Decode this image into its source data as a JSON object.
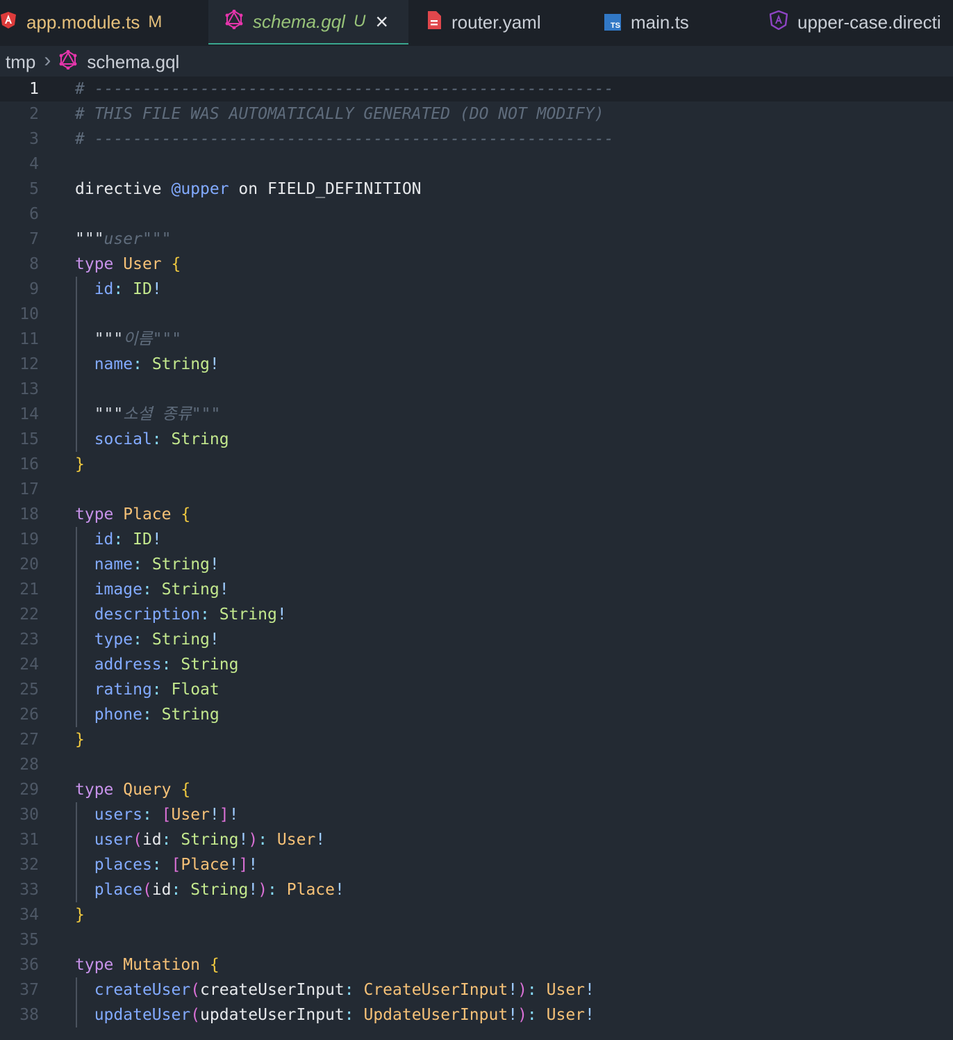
{
  "tabs": [
    {
      "label": "app.module.ts",
      "status": "M",
      "icon": "angular-icon",
      "color": "#e5c07b"
    },
    {
      "label": "schema.gql",
      "status": "U",
      "icon": "graphql-icon",
      "color": "#98c379"
    },
    {
      "label": "router.yaml",
      "status": "",
      "icon": "yaml-file-icon",
      "color": "#c9ced6"
    },
    {
      "label": "main.ts",
      "status": "",
      "icon": "typescript-icon",
      "color": "#c9ced6"
    },
    {
      "label": "upper-case.directi",
      "status": "",
      "icon": "angular-directive-icon",
      "color": "#c9ced6"
    }
  ],
  "ts_badge": "TS",
  "close_glyph": "×",
  "breadcrumb": {
    "folder": "tmp",
    "separator": "›",
    "file": "schema.gql"
  },
  "editor": {
    "current_line": 1,
    "lines": [
      [
        [
          "c-comment",
          "# ------------------------------------------------------"
        ]
      ],
      [
        [
          "c-comment",
          "# THIS FILE WAS AUTOMATICALLY GENERATED (DO NOT MODIFY)"
        ]
      ],
      [
        [
          "c-comment",
          "# ------------------------------------------------------"
        ]
      ],
      [],
      [
        [
          "c-plain",
          "directive "
        ],
        [
          "c-dir",
          "@upper"
        ],
        [
          "c-plain",
          " on FIELD_DEFINITION"
        ]
      ],
      [],
      [
        [
          "c-quote",
          "\"\"\""
        ],
        [
          "c-comment",
          "user"
        ],
        [
          "c-comment",
          "\"\"\""
        ]
      ],
      [
        [
          "c-kw",
          "type"
        ],
        [
          "c-plain",
          " "
        ],
        [
          "c-type",
          "User"
        ],
        [
          "c-plain",
          " "
        ],
        [
          "c-brace",
          "{"
        ]
      ],
      [
        [
          "c-plain",
          "  "
        ],
        [
          "c-field",
          "id"
        ],
        [
          "c-punc",
          ":"
        ],
        [
          "c-plain",
          " "
        ],
        [
          "c-scalar",
          "ID"
        ],
        [
          "c-bang",
          "!"
        ]
      ],
      [],
      [
        [
          "c-plain",
          "  "
        ],
        [
          "c-quote",
          "\"\"\""
        ],
        [
          "c-comment",
          "이름"
        ],
        [
          "c-comment",
          "\"\"\""
        ]
      ],
      [
        [
          "c-plain",
          "  "
        ],
        [
          "c-field",
          "name"
        ],
        [
          "c-punc",
          ":"
        ],
        [
          "c-plain",
          " "
        ],
        [
          "c-scalar",
          "String"
        ],
        [
          "c-bang",
          "!"
        ]
      ],
      [],
      [
        [
          "c-plain",
          "  "
        ],
        [
          "c-quote",
          "\"\"\""
        ],
        [
          "c-comment",
          "소셜 종류"
        ],
        [
          "c-comment",
          "\"\"\""
        ]
      ],
      [
        [
          "c-plain",
          "  "
        ],
        [
          "c-field",
          "social"
        ],
        [
          "c-punc",
          ":"
        ],
        [
          "c-plain",
          " "
        ],
        [
          "c-scalar",
          "String"
        ]
      ],
      [
        [
          "c-brace",
          "}"
        ]
      ],
      [],
      [
        [
          "c-kw",
          "type"
        ],
        [
          "c-plain",
          " "
        ],
        [
          "c-type",
          "Place"
        ],
        [
          "c-plain",
          " "
        ],
        [
          "c-brace",
          "{"
        ]
      ],
      [
        [
          "c-plain",
          "  "
        ],
        [
          "c-field",
          "id"
        ],
        [
          "c-punc",
          ":"
        ],
        [
          "c-plain",
          " "
        ],
        [
          "c-scalar",
          "ID"
        ],
        [
          "c-bang",
          "!"
        ]
      ],
      [
        [
          "c-plain",
          "  "
        ],
        [
          "c-field",
          "name"
        ],
        [
          "c-punc",
          ":"
        ],
        [
          "c-plain",
          " "
        ],
        [
          "c-scalar",
          "String"
        ],
        [
          "c-bang",
          "!"
        ]
      ],
      [
        [
          "c-plain",
          "  "
        ],
        [
          "c-field",
          "image"
        ],
        [
          "c-punc",
          ":"
        ],
        [
          "c-plain",
          " "
        ],
        [
          "c-scalar",
          "String"
        ],
        [
          "c-bang",
          "!"
        ]
      ],
      [
        [
          "c-plain",
          "  "
        ],
        [
          "c-field",
          "description"
        ],
        [
          "c-punc",
          ":"
        ],
        [
          "c-plain",
          " "
        ],
        [
          "c-scalar",
          "String"
        ],
        [
          "c-bang",
          "!"
        ]
      ],
      [
        [
          "c-plain",
          "  "
        ],
        [
          "c-field",
          "type"
        ],
        [
          "c-punc",
          ":"
        ],
        [
          "c-plain",
          " "
        ],
        [
          "c-scalar",
          "String"
        ],
        [
          "c-bang",
          "!"
        ]
      ],
      [
        [
          "c-plain",
          "  "
        ],
        [
          "c-field",
          "address"
        ],
        [
          "c-punc",
          ":"
        ],
        [
          "c-plain",
          " "
        ],
        [
          "c-scalar",
          "String"
        ]
      ],
      [
        [
          "c-plain",
          "  "
        ],
        [
          "c-field",
          "rating"
        ],
        [
          "c-punc",
          ":"
        ],
        [
          "c-plain",
          " "
        ],
        [
          "c-scalar",
          "Float"
        ]
      ],
      [
        [
          "c-plain",
          "  "
        ],
        [
          "c-field",
          "phone"
        ],
        [
          "c-punc",
          ":"
        ],
        [
          "c-plain",
          " "
        ],
        [
          "c-scalar",
          "String"
        ]
      ],
      [
        [
          "c-brace",
          "}"
        ]
      ],
      [],
      [
        [
          "c-kw",
          "type"
        ],
        [
          "c-plain",
          " "
        ],
        [
          "c-type",
          "Query"
        ],
        [
          "c-plain",
          " "
        ],
        [
          "c-brace",
          "{"
        ]
      ],
      [
        [
          "c-plain",
          "  "
        ],
        [
          "c-field",
          "users"
        ],
        [
          "c-punc",
          ":"
        ],
        [
          "c-plain",
          " "
        ],
        [
          "c-bracket",
          "["
        ],
        [
          "c-type",
          "User"
        ],
        [
          "c-bang",
          "!"
        ],
        [
          "c-bracket",
          "]"
        ],
        [
          "c-bang",
          "!"
        ]
      ],
      [
        [
          "c-plain",
          "  "
        ],
        [
          "c-field",
          "user"
        ],
        [
          "c-bracket",
          "("
        ],
        [
          "c-plain",
          "id"
        ],
        [
          "c-punc",
          ":"
        ],
        [
          "c-plain",
          " "
        ],
        [
          "c-scalar",
          "String"
        ],
        [
          "c-bang",
          "!"
        ],
        [
          "c-bracket",
          ")"
        ],
        [
          "c-punc",
          ":"
        ],
        [
          "c-plain",
          " "
        ],
        [
          "c-type",
          "User"
        ],
        [
          "c-bang",
          "!"
        ]
      ],
      [
        [
          "c-plain",
          "  "
        ],
        [
          "c-field",
          "places"
        ],
        [
          "c-punc",
          ":"
        ],
        [
          "c-plain",
          " "
        ],
        [
          "c-bracket",
          "["
        ],
        [
          "c-type",
          "Place"
        ],
        [
          "c-bang",
          "!"
        ],
        [
          "c-bracket",
          "]"
        ],
        [
          "c-bang",
          "!"
        ]
      ],
      [
        [
          "c-plain",
          "  "
        ],
        [
          "c-field",
          "place"
        ],
        [
          "c-bracket",
          "("
        ],
        [
          "c-plain",
          "id"
        ],
        [
          "c-punc",
          ":"
        ],
        [
          "c-plain",
          " "
        ],
        [
          "c-scalar",
          "String"
        ],
        [
          "c-bang",
          "!"
        ],
        [
          "c-bracket",
          ")"
        ],
        [
          "c-punc",
          ":"
        ],
        [
          "c-plain",
          " "
        ],
        [
          "c-type",
          "Place"
        ],
        [
          "c-bang",
          "!"
        ]
      ],
      [
        [
          "c-brace",
          "}"
        ]
      ],
      [],
      [
        [
          "c-kw",
          "type"
        ],
        [
          "c-plain",
          " "
        ],
        [
          "c-type",
          "Mutation"
        ],
        [
          "c-plain",
          " "
        ],
        [
          "c-brace",
          "{"
        ]
      ],
      [
        [
          "c-plain",
          "  "
        ],
        [
          "c-field",
          "createUser"
        ],
        [
          "c-bracket",
          "("
        ],
        [
          "c-plain",
          "createUserInput"
        ],
        [
          "c-punc",
          ":"
        ],
        [
          "c-plain",
          " "
        ],
        [
          "c-type",
          "CreateUserInput"
        ],
        [
          "c-bang",
          "!"
        ],
        [
          "c-bracket",
          ")"
        ],
        [
          "c-punc",
          ":"
        ],
        [
          "c-plain",
          " "
        ],
        [
          "c-type",
          "User"
        ],
        [
          "c-bang",
          "!"
        ]
      ],
      [
        [
          "c-plain",
          "  "
        ],
        [
          "c-field",
          "updateUser"
        ],
        [
          "c-bracket",
          "("
        ],
        [
          "c-plain",
          "updateUserInput"
        ],
        [
          "c-punc",
          ":"
        ],
        [
          "c-plain",
          " "
        ],
        [
          "c-type",
          "UpdateUserInput"
        ],
        [
          "c-bang",
          "!"
        ],
        [
          "c-bracket",
          ")"
        ],
        [
          "c-punc",
          ":"
        ],
        [
          "c-plain",
          " "
        ],
        [
          "c-type",
          "User"
        ],
        [
          "c-bang",
          "!"
        ]
      ]
    ]
  }
}
